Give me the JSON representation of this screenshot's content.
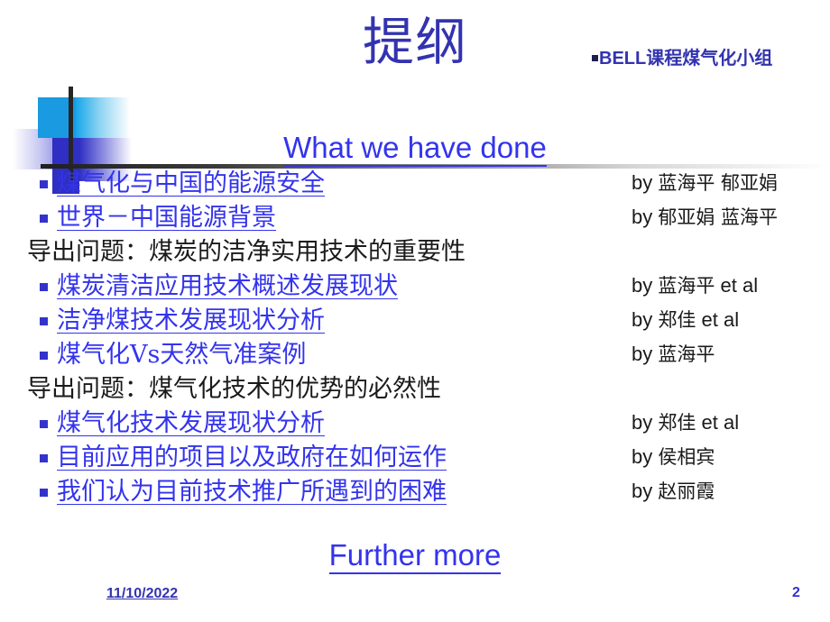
{
  "slide": {
    "title": "提纲",
    "brand": "BELL课程煤气化小组",
    "brand_bullet_icon": "small-square-bullet"
  },
  "sections": {
    "what_we_have_done": "What we have done",
    "further_more": "Further more"
  },
  "items": [
    {
      "kind": "bullet",
      "text": "煤气化与中国的能源安全",
      "by_label": "by",
      "author": "蓝海平 郁亚娟",
      "suffix": "",
      "underline": true
    },
    {
      "kind": "bullet",
      "text": "世界－中国能源背景",
      "by_label": "by",
      "author": "郁亚娟 蓝海平",
      "suffix": "",
      "underline": true
    },
    {
      "kind": "note",
      "text": "导出问题：煤炭的洁净实用技术的重要性",
      "by_label": "",
      "author": "",
      "suffix": "",
      "underline": false
    },
    {
      "kind": "bullet",
      "text": "煤炭清洁应用技术概述发展现状",
      "by_label": "by",
      "author": "蓝海平",
      "suffix": "et al",
      "underline": true
    },
    {
      "kind": "bullet",
      "text": "洁净煤技术发展现状分析",
      "by_label": "by",
      "author": "郑佳",
      "suffix": "et al",
      "underline": true
    },
    {
      "kind": "bullet",
      "text": "煤气化Vs天然气准案例",
      "by_label": "by",
      "author": "蓝海平",
      "suffix": "",
      "underline": false
    },
    {
      "kind": "note",
      "text": "导出问题：煤气化技术的优势的必然性",
      "by_label": "",
      "author": "",
      "suffix": "",
      "underline": false
    },
    {
      "kind": "bullet",
      "text": "煤气化技术发展现状分析",
      "by_label": "by",
      "author": "郑佳",
      "suffix": "et al",
      "underline": true
    },
    {
      "kind": "bullet",
      "text": "目前应用的项目以及政府在如何运作",
      "by_label": "by",
      "author": "侯相宾",
      "suffix": "",
      "underline": true
    },
    {
      "kind": "bullet",
      "text": "我们认为目前技术推广所遇到的困难",
      "by_label": "by",
      "author": "赵丽霞",
      "suffix": "",
      "underline": true
    }
  ],
  "footer": {
    "date": "11/10/2022",
    "page_number": "2"
  },
  "colors": {
    "title_blue": "#3333b0",
    "link_blue": "#3333ee",
    "bullet_blue": "#3333cc",
    "deco_cyan": "#1a9ae0",
    "deco_blue": "#2f2fc4",
    "text_black": "#1a1a1a"
  }
}
